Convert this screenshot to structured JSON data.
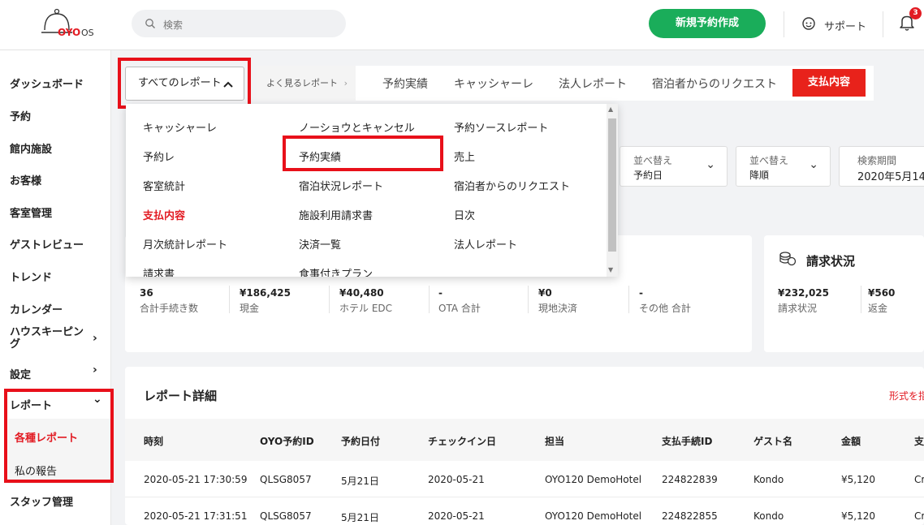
{
  "header": {
    "logo_brand": "OYO",
    "logo_suffix": "OS",
    "search_placeholder": "検索",
    "new_booking": "新規予約作成",
    "support": "サポート",
    "notifications": "3"
  },
  "sidebar": {
    "items": [
      "ダッシュボード",
      "予約",
      "館内施設",
      "お客様",
      "客室管理",
      "ゲストレビュー",
      "トレンド",
      "カレンダー",
      "ハウスキーピング",
      "設定",
      "レポート"
    ],
    "sub_items": [
      "各種レポート",
      "私の報告"
    ],
    "bottom": "スタッフ管理",
    "chevron_right": "›",
    "chevron_down": "⌄"
  },
  "tabs": {
    "all_reports": "すべてのレポート",
    "frequent": "よく見るレポート",
    "items": [
      "予約実績",
      "キャッシャーレ",
      "法人レポート",
      "宿泊者からのリクエスト"
    ],
    "active": "支払内容"
  },
  "menu": {
    "col1": [
      "キャッシャーレ",
      "予約レ",
      "客室統計",
      "支払内容",
      "月次統計レポート",
      "請求書"
    ],
    "col2": [
      "ノーショウとキャンセル",
      "予約実績",
      "宿泊状況レポート",
      "施設利用請求書",
      "決済一覧",
      "食事付きプラン"
    ],
    "col3": [
      "予約ソースレポート",
      "売上",
      "宿泊者からのリクエスト",
      "日次",
      "法人レポート"
    ]
  },
  "filters": {
    "sort_label": "並べ替え",
    "sort_by": "予約日",
    "order_label": "並べ替え",
    "order": "降順",
    "period_label": "検索期間",
    "period": "2020年5月14"
  },
  "summary": {
    "stats": [
      {
        "value": "36",
        "label": "合計手続き数"
      },
      {
        "value": "¥186,425",
        "label": "現金"
      },
      {
        "value": "¥40,480",
        "label": "ホテル EDC"
      },
      {
        "value": "-",
        "label": "OTA 合計"
      },
      {
        "value": "¥0",
        "label": "現地決済"
      },
      {
        "value": "-",
        "label": "その他 合計"
      }
    ]
  },
  "billing": {
    "title": "請求状況",
    "stats": [
      {
        "value": "¥232,025",
        "label": "請求状況"
      },
      {
        "value": "¥560",
        "label": "返金"
      }
    ]
  },
  "detail": {
    "title": "レポート詳細",
    "format": "形式を指",
    "columns": [
      "時刻",
      "OYO予約ID",
      "予約日付",
      "チェックイン日",
      "担当",
      "支払手続ID",
      "ゲスト名",
      "金額",
      "支"
    ],
    "rows": [
      [
        "2020-05-21 17:30:59",
        "QLSG8057",
        "5月21日",
        "2020-05-21",
        "OYO120 DemoHotel",
        "224822839",
        "Kondo",
        "¥5,120",
        "Cr"
      ],
      [
        "2020-05-21 17:31:51",
        "QLSG8057",
        "5月21日",
        "2020-05-21",
        "OYO120 DemoHotel",
        "224822855",
        "Kondo",
        "¥5,120",
        "Cr"
      ]
    ]
  },
  "colors": {
    "brand_red": "#e21b23",
    "green": "#1aad5a",
    "highlight": "#e8101a"
  }
}
